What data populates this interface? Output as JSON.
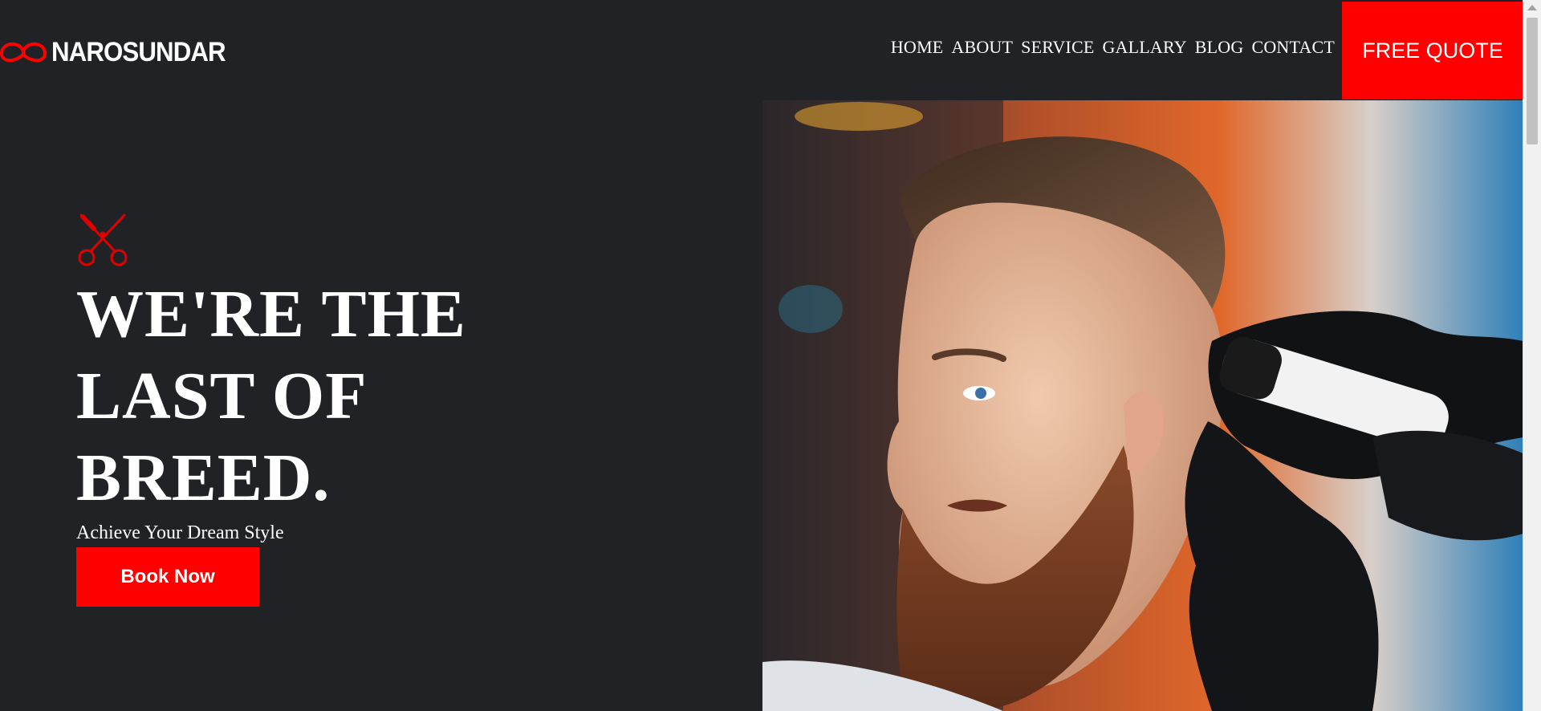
{
  "brand": {
    "name": "NAROSUNDAR",
    "logo_icon": "mustache-icon",
    "accent": "#ff0000"
  },
  "nav": {
    "items": [
      "HOME",
      "ABOUT",
      "SERVICE",
      "GALLARY",
      "BLOG",
      "CONTACT"
    ]
  },
  "header": {
    "quote_label": "FREE QUOTE"
  },
  "hero": {
    "icon": "scissors-icon",
    "headline_line1": "WE'RE THE",
    "headline_line2": "LAST OF",
    "headline_line3": "BREED.",
    "tagline": "Achieve Your Dream Style",
    "cta_label": "Book Now",
    "image": "barber-trimming-bearded-man-photo"
  },
  "colors": {
    "background": "#202226",
    "accent": "#ff0000",
    "text": "#ffffff"
  }
}
